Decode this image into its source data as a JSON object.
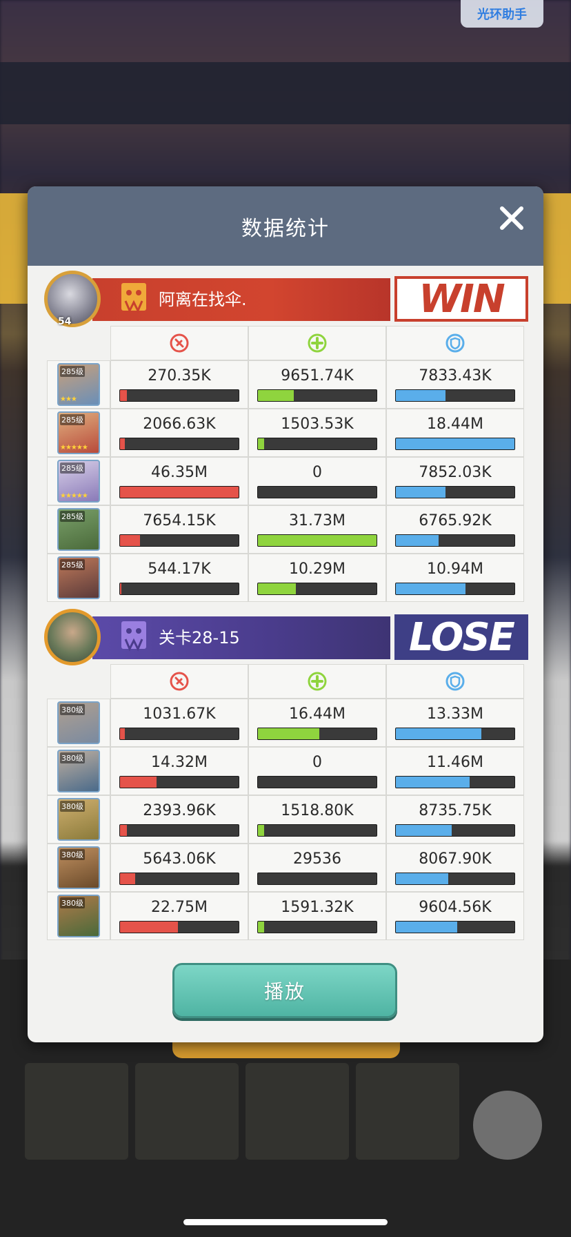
{
  "assist_label": "光环助手",
  "dialog": {
    "title": "数据统计",
    "play_label": "播放"
  },
  "teams": [
    {
      "name": "阿离在找伞.",
      "result": "WIN",
      "player_level": "54",
      "heroes": [
        {
          "level": "285级",
          "stars": "★★★",
          "dmg": "270.35K",
          "heal": "9651.74K",
          "tank": "7833.43K",
          "dmg_pct": 0.06,
          "heal_pct": 0.3,
          "tank_pct": 0.42
        },
        {
          "level": "285级",
          "stars": "★★★★★",
          "dmg": "2066.63K",
          "heal": "1503.53K",
          "tank": "18.44M",
          "dmg_pct": 0.04,
          "heal_pct": 0.05,
          "tank_pct": 1.0
        },
        {
          "level": "285级",
          "stars": "★★★★★",
          "dmg": "46.35M",
          "heal": "0",
          "tank": "7852.03K",
          "dmg_pct": 1.0,
          "heal_pct": 0.0,
          "tank_pct": 0.42
        },
        {
          "level": "285级",
          "stars": "",
          "dmg": "7654.15K",
          "heal": "31.73M",
          "tank": "6765.92K",
          "dmg_pct": 0.17,
          "heal_pct": 1.0,
          "tank_pct": 0.36
        },
        {
          "level": "285级",
          "stars": "",
          "dmg": "544.17K",
          "heal": "10.29M",
          "tank": "10.94M",
          "dmg_pct": 0.01,
          "heal_pct": 0.32,
          "tank_pct": 0.59
        }
      ]
    },
    {
      "name": "关卡28-15",
      "result": "LOSE",
      "player_level": "",
      "heroes": [
        {
          "level": "380级",
          "stars": "",
          "dmg": "1031.67K",
          "heal": "16.44M",
          "tank": "13.33M",
          "dmg_pct": 0.04,
          "heal_pct": 0.52,
          "tank_pct": 0.72
        },
        {
          "level": "380级",
          "stars": "",
          "dmg": "14.32M",
          "heal": "0",
          "tank": "11.46M",
          "dmg_pct": 0.31,
          "heal_pct": 0.0,
          "tank_pct": 0.62
        },
        {
          "level": "380级",
          "stars": "",
          "dmg": "2393.96K",
          "heal": "1518.80K",
          "tank": "8735.75K",
          "dmg_pct": 0.06,
          "heal_pct": 0.05,
          "tank_pct": 0.47
        },
        {
          "level": "380级",
          "stars": "",
          "dmg": "5643.06K",
          "heal": "29536",
          "tank": "8067.90K",
          "dmg_pct": 0.13,
          "heal_pct": 0.0,
          "tank_pct": 0.44
        },
        {
          "level": "380级",
          "stars": "",
          "dmg": "22.75M",
          "heal": "1591.32K",
          "tank": "9604.56K",
          "dmg_pct": 0.49,
          "heal_pct": 0.05,
          "tank_pct": 0.52
        }
      ]
    }
  ],
  "colors": {
    "win": "#c8402d",
    "lose": "#4a3c8c",
    "damage": "#e5534a",
    "heal": "#8fd43e",
    "tank": "#5aaeea"
  },
  "icons": {
    "damage": "sword-circle-icon",
    "heal": "plus-circle-icon",
    "tank": "shield-icon",
    "close": "close-icon"
  }
}
